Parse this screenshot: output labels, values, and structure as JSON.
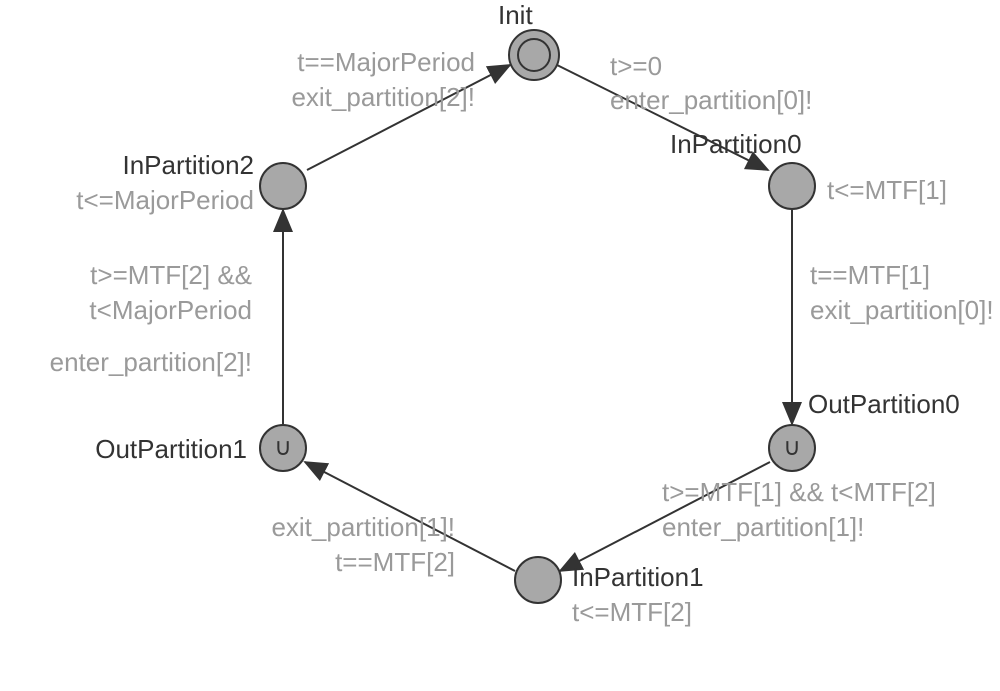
{
  "states": {
    "init": {
      "name": "Init"
    },
    "inP0": {
      "name": "InPartition0",
      "invariant": "t<=MTF[1]"
    },
    "outP0": {
      "name": "OutPartition0"
    },
    "inP1": {
      "name": "InPartition1",
      "invariant": "t<=MTF[2]"
    },
    "outP1": {
      "name": "OutPartition1"
    },
    "inP2": {
      "name": "InPartition2",
      "invariant": "t<=MajorPeriod"
    }
  },
  "edges": {
    "init_to_inP0": {
      "guard": "t>=0",
      "sync": "enter_partition[0]!"
    },
    "inP0_to_outP0": {
      "guard": "t==MTF[1]",
      "sync": "exit_partition[0]!"
    },
    "outP0_to_inP1": {
      "guard": "t>=MTF[1] && t<MTF[2]",
      "sync": "enter_partition[1]!"
    },
    "inP1_to_outP1": {
      "sync": "exit_partition[1]!",
      "guard": "t==MTF[2]"
    },
    "outP1_to_inP2": {
      "guard": "t>=MTF[2] &&",
      "guard2": "t<MajorPeriod",
      "sync": "enter_partition[2]!"
    },
    "inP2_to_init": {
      "guard": "t==MajorPeriod",
      "sync": "exit_partition[2]!"
    }
  },
  "chart_data": {
    "type": "diagram",
    "title": "",
    "nodes": [
      {
        "id": "Init",
        "kind": "initial"
      },
      {
        "id": "InPartition0",
        "invariant": "t<=MTF[1]"
      },
      {
        "id": "OutPartition0",
        "kind": "urgent"
      },
      {
        "id": "InPartition1",
        "invariant": "t<=MTF[2]"
      },
      {
        "id": "OutPartition1",
        "kind": "urgent"
      },
      {
        "id": "InPartition2",
        "invariant": "t<=MajorPeriod"
      }
    ],
    "edges": [
      {
        "from": "Init",
        "to": "InPartition0",
        "guard": "t>=0",
        "sync": "enter_partition[0]!"
      },
      {
        "from": "InPartition0",
        "to": "OutPartition0",
        "guard": "t==MTF[1]",
        "sync": "exit_partition[0]!"
      },
      {
        "from": "OutPartition0",
        "to": "InPartition1",
        "guard": "t>=MTF[1] && t<MTF[2]",
        "sync": "enter_partition[1]!"
      },
      {
        "from": "InPartition1",
        "to": "OutPartition1",
        "guard": "t==MTF[2]",
        "sync": "exit_partition[1]!"
      },
      {
        "from": "OutPartition1",
        "to": "InPartition2",
        "guard": "t>=MTF[2] && t<MajorPeriod",
        "sync": "enter_partition[2]!"
      },
      {
        "from": "InPartition2",
        "to": "Init",
        "guard": "t==MajorPeriod",
        "sync": "exit_partition[2]!"
      }
    ]
  }
}
